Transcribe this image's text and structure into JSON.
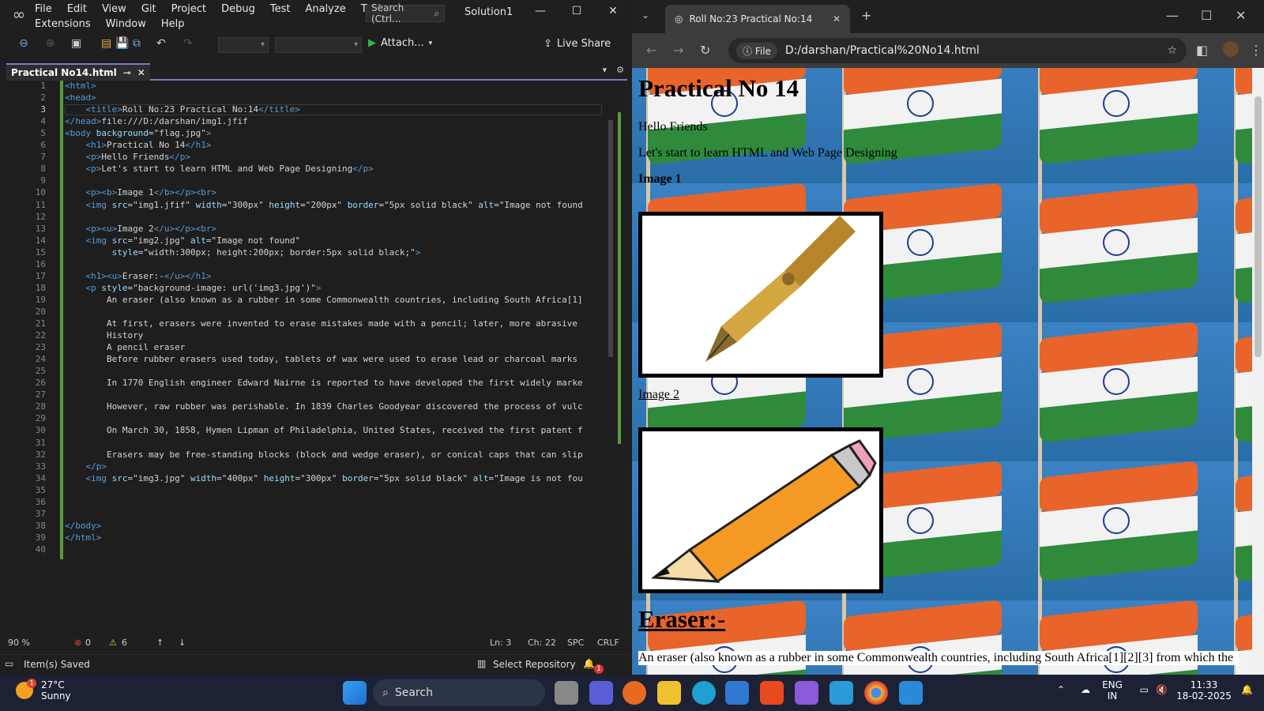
{
  "vs": {
    "menu_row1": [
      "File",
      "Edit",
      "View",
      "Git",
      "Project",
      "Debug",
      "Test",
      "Analyze",
      "Tools"
    ],
    "menu_row2": [
      "Extensions",
      "Window",
      "Help"
    ],
    "search_placeholder": "Search (Ctrl...",
    "solution": "Solution1",
    "attach_label": "Attach...",
    "liveshare_label": "Live Share",
    "tab_title": "Practical No14.html",
    "code_lines": [
      "<html>",
      "<head>",
      "    <title>Roll No:23 Practical No:14</title>",
      "</head>file:///D:/darshan/img1.jfif",
      "<body background=\"flag.jpg\">",
      "    <h1>Practical No 14</h1>",
      "    <p>Hello Friends</p>",
      "    <p>Let's start to learn HTML and Web Page Designing</p>",
      "",
      "    <p><b>Image 1</b></p><br>",
      "    <img src=\"img1.jfif\" width=\"300px\" height=\"200px\" border=\"5px solid black\" alt=\"Image not found",
      "",
      "    <p><u>Image 2</u></p><br>",
      "    <img src=\"img2.jpg\" alt=\"Image not found\"",
      "         style=\"width:300px; height:200px; border:5px solid black;\">",
      "",
      "    <h1><u>Eraser:-</u></h1>",
      "    <p style=\"background-image: url('img3.jpg')\">",
      "        An eraser (also known as a rubber in some Commonwealth countries, including South Africa[1]",
      "",
      "        At first, erasers were invented to erase mistakes made with a pencil; later, more abrasive",
      "        History",
      "        A pencil eraser",
      "        Before rubber erasers used today, tablets of wax were used to erase lead or charcoal marks",
      "",
      "        In 1770 English engineer Edward Nairne is reported to have developed the first widely marke",
      "",
      "        However, raw rubber was perishable. In 1839 Charles Goodyear discovered the process of vulc",
      "",
      "        On March 30, 1858, Hymen Lipman of Philadelphia, United States, received the first patent f",
      "",
      "        Erasers may be free-standing blocks (block and wedge eraser), or conical caps that can slip",
      "    </p>",
      "    <img src=\"img3.jpg\" width=\"400px\" height=\"300px\" border=\"5px solid black\" alt=\"Image is not fou",
      "",
      "",
      "",
      "</body>",
      "</html>",
      ""
    ],
    "zoom": "90 %",
    "errors": "0",
    "warnings": "6",
    "ln": "Ln: 3",
    "ch": "Ch: 22",
    "spc": "SPC",
    "crlf": "CRLF",
    "status_text": "Item(s) Saved",
    "select_repo": "Select Repository",
    "notif_count": "1"
  },
  "chrome": {
    "tab_title": "Roll No:23 Practical No:14",
    "chip": "File",
    "url": "D:/darshan/Practical%20No14.html",
    "page": {
      "h1": "Practical No 14",
      "p1": "Hello Friends",
      "p2": "Let's start to learn HTML and Web Page Designing",
      "img1_label": "Image 1",
      "img2_label": "Image 2",
      "h1b": "Eraser:-",
      "eraser_text": "An eraser (also known as a rubber in some Commonwealth countries, including South Africa[1][2][3] from which the"
    }
  },
  "taskbar": {
    "temp": "27°C",
    "weather": "Sunny",
    "weather_badge": "1",
    "search": "Search",
    "lang1": "ENG",
    "lang2": "IN",
    "time": "11:33",
    "date": "18-02-2025"
  }
}
